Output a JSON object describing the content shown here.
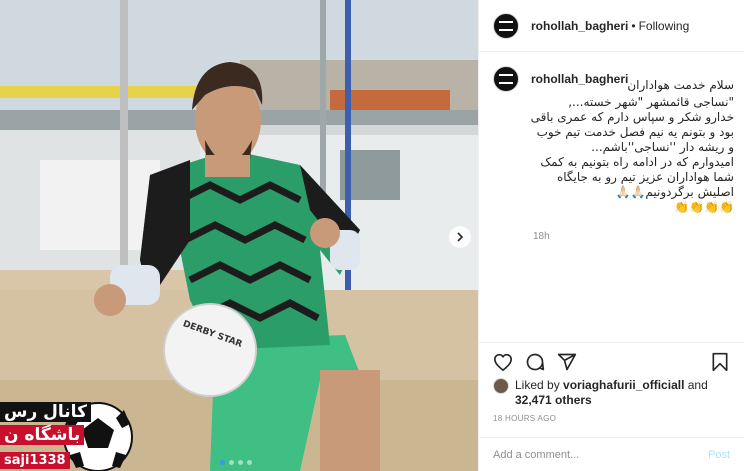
{
  "header": {
    "username": "rohollah_bagheri",
    "separator": "•",
    "follow_status": "Following"
  },
  "caption": {
    "username": "rohollah_bagheri",
    "lines": [
      "سلام خدمت هواداران",
      "\"نساجی قائمشهر \"شهر خسته...,",
      "خدارو شکر و سپاس دارم که عمری باقی",
      "بود و بتونم یه نیم فصل خدمت تیم خوب",
      "و ریشه دار ''نساجی''باشم...",
      "امیدوارم که در ادامه راه بتونیم به کمک",
      "شما هواداران عزیز تیم رو به جایگاه",
      "اصلیش برگردونیم🙏🏻🙏🏻",
      "👏👏👏👏"
    ],
    "time": "18h"
  },
  "likes": {
    "prefix": "Liked by",
    "liker": "voriaghafurii_officiall",
    "conjunction": "and",
    "others": "32,471 others"
  },
  "post_time": "18 HOURS AGO",
  "comment": {
    "placeholder": "Add a comment...",
    "post_label": "Post"
  },
  "watermark": {
    "line1": "کانال رس",
    "line2": "باشگاه ن",
    "line3": "saji1338"
  },
  "icons": {
    "like": "heart-icon",
    "comment": "comment-icon",
    "share": "share-icon",
    "save": "bookmark-icon",
    "next": "chevron-right-icon"
  },
  "colors": {
    "accent": "#3897f0",
    "post_disabled": "#b2dffc",
    "muted": "#8e8e8e"
  },
  "carousel": {
    "count": 4,
    "active_index": 0
  }
}
